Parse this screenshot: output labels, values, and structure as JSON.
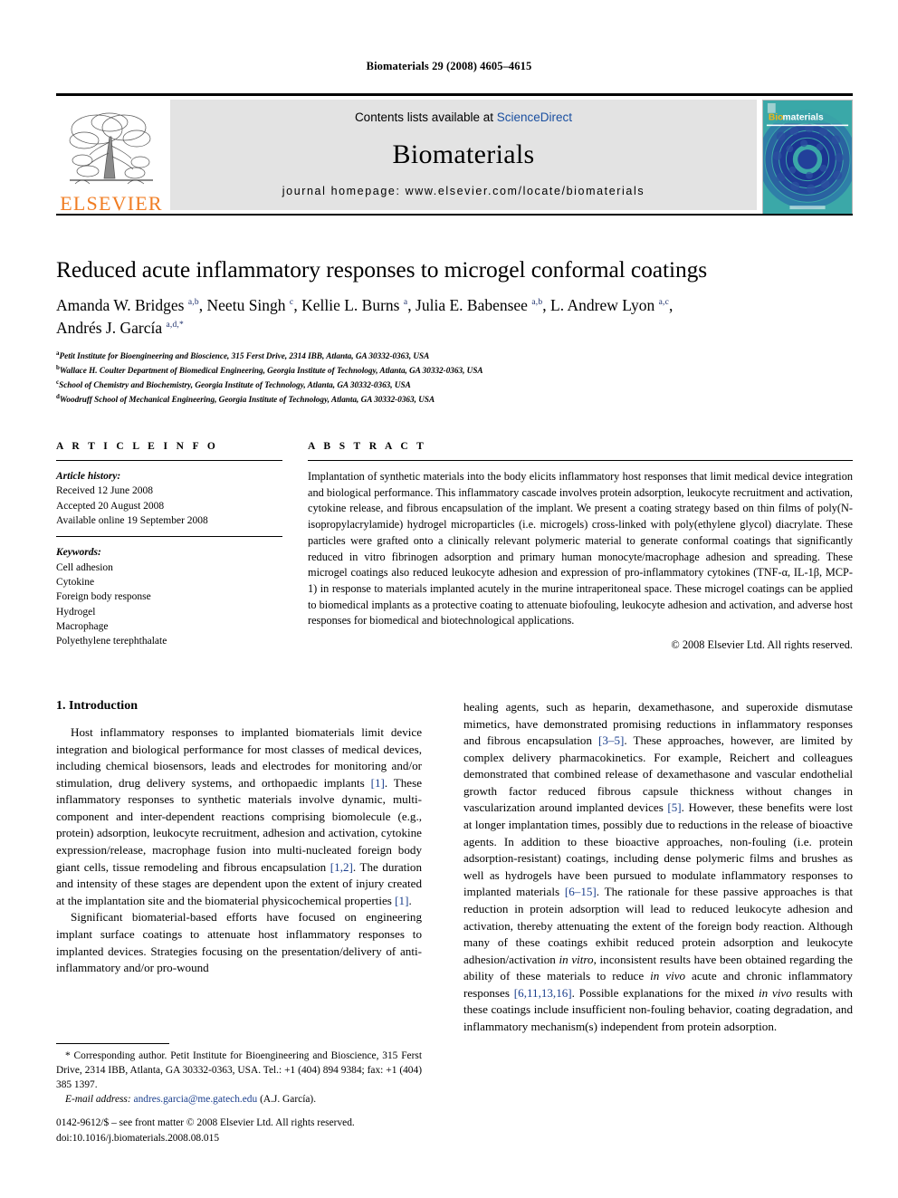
{
  "running_head": "Biomaterials 29 (2008) 4605–4615",
  "masthead": {
    "publisher": "ELSEVIER",
    "contents_prefix": "Contents lists available at ",
    "contents_link": "ScienceDirect",
    "journal_name": "Biomaterials",
    "homepage": "journal homepage: www.elsevier.com/locate/biomaterials",
    "cover_title_prefix": "Bio",
    "cover_title_suffix": "materials",
    "accent_orange": "#F07C22",
    "link_blue": "#1a4fa0",
    "banner_grey": "#e3e3e3"
  },
  "article": {
    "title": "Reduced acute inflammatory responses to microgel conformal coatings",
    "authors": "Amanda W. Bridges a,b, Neetu Singh c, Kellie L. Burns a, Julia E. Babensee a,b, L. Andrew Lyon a,c, Andrés J. García a,d,*",
    "affiliations": [
      "Petit Institute for Bioengineering and Bioscience, 315 Ferst Drive, 2314 IBB, Atlanta, GA 30332-0363, USA",
      "Wallace H. Coulter Department of Biomedical Engineering, Georgia Institute of Technology, Atlanta, GA 30332-0363, USA",
      "School of Chemistry and Biochemistry, Georgia Institute of Technology, Atlanta, GA 30332-0363, USA",
      "Woodruff School of Mechanical Engineering, Georgia Institute of Technology, Atlanta, GA 30332-0363, USA"
    ],
    "affiliation_marks": [
      "a",
      "b",
      "c",
      "d"
    ]
  },
  "article_info": {
    "heading": "A R T I C L E  I N F O",
    "history_label": "Article history:",
    "history": [
      "Received 12 June 2008",
      "Accepted 20 August 2008",
      "Available online 19 September 2008"
    ],
    "keywords_label": "Keywords:",
    "keywords": [
      "Cell adhesion",
      "Cytokine",
      "Foreign body response",
      "Hydrogel",
      "Macrophage",
      "Polyethylene terephthalate"
    ]
  },
  "abstract": {
    "heading": "A B S T R A C T",
    "text": "Implantation of synthetic materials into the body elicits inflammatory host responses that limit medical device integration and biological performance. This inflammatory cascade involves protein adsorption, leukocyte recruitment and activation, cytokine release, and fibrous encapsulation of the implant. We present a coating strategy based on thin films of poly(N-isopropylacrylamide) hydrogel microparticles (i.e. microgels) cross-linked with poly(ethylene glycol) diacrylate. These particles were grafted onto a clinically relevant polymeric material to generate conformal coatings that significantly reduced in vitro fibrinogen adsorption and primary human monocyte/macrophage adhesion and spreading. These microgel coatings also reduced leukocyte adhesion and expression of pro-inflammatory cytokines (TNF-α, IL-1β, MCP-1) in response to materials implanted acutely in the murine intraperitoneal space. These microgel coatings can be applied to biomedical implants as a protective coating to attenuate biofouling, leukocyte adhesion and activation, and adverse host responses for biomedical and biotechnological applications.",
    "copyright": "© 2008 Elsevier Ltd. All rights reserved."
  },
  "introduction": {
    "section_number_title": "1. Introduction",
    "left_paragraphs": [
      "Host inflammatory responses to implanted biomaterials limit device integration and biological performance for most classes of medical devices, including chemical biosensors, leads and electrodes for monitoring and/or stimulation, drug delivery systems, and orthopaedic implants [1]. These inflammatory responses to synthetic materials involve dynamic, multi-component and inter-dependent reactions comprising biomolecule (e.g., protein) adsorption, leukocyte recruitment, adhesion and activation, cytokine expression/release, macrophage fusion into multi-nucleated foreign body giant cells, tissue remodeling and fibrous encapsulation [1,2]. The duration and intensity of these stages are dependent upon the extent of injury created at the implantation site and the biomaterial physicochemical properties [1].",
      "Significant biomaterial-based efforts have focused on engineering implant surface coatings to attenuate host inflammatory responses to implanted devices. Strategies focusing on the presentation/delivery of anti-inflammatory and/or pro-wound"
    ],
    "right_paragraphs": [
      "healing agents, such as heparin, dexamethasone, and superoxide dismutase mimetics, have demonstrated promising reductions in inflammatory responses and fibrous encapsulation [3–5]. These approaches, however, are limited by complex delivery pharmacokinetics. For example, Reichert and colleagues demonstrated that combined release of dexamethasone and vascular endothelial growth factor reduced fibrous capsule thickness without changes in vascularization around implanted devices [5]. However, these benefits were lost at longer implantation times, possibly due to reductions in the release of bioactive agents. In addition to these bioactive approaches, non-fouling (i.e. protein adsorption-resistant) coatings, including dense polymeric films and brushes as well as hydrogels have been pursued to modulate inflammatory responses to implanted materials [6–15]. The rationale for these passive approaches is that reduction in protein adsorption will lead to reduced leukocyte adhesion and activation, thereby attenuating the extent of the foreign body reaction. Although many of these coatings exhibit reduced protein adsorption and leukocyte adhesion/activation in vitro, inconsistent results have been obtained regarding the ability of these materials to reduce in vivo acute and chronic inflammatory responses [6,11,13,16]. Possible explanations for the mixed in vivo results with these coatings include insufficient non-fouling behavior, coating degradation, and inflammatory mechanism(s) independent from protein adsorption."
    ]
  },
  "footnote": {
    "corresponding": "* Corresponding author. Petit Institute for Bioengineering and Bioscience, 315 Ferst Drive, 2314 IBB, Atlanta, GA 30332-0363, USA. Tel.: +1 (404) 894 9384; fax: +1 (404) 385 1397.",
    "email_label": "E-mail address:",
    "email": "andres.garcia@me.gatech.edu",
    "email_suffix": "(A.J. García)."
  },
  "footer": {
    "issn_line": "0142-9612/$ – see front matter © 2008 Elsevier Ltd. All rights reserved.",
    "doi_line": "doi:10.1016/j.biomaterials.2008.08.015"
  }
}
